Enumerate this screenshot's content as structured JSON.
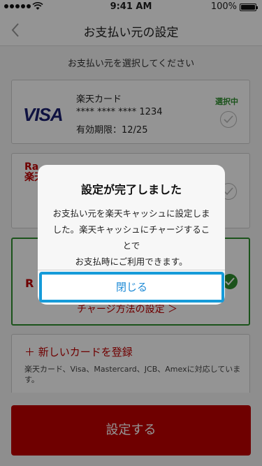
{
  "status_bar": {
    "time": "9:41 AM",
    "battery": "100%"
  },
  "nav": {
    "title": "お支払い元の設定"
  },
  "instruction": "お支払い元を選択してください",
  "cards": {
    "visa": {
      "brand": "VISA",
      "name": "楽天カード",
      "number": "**** **** **** 1234",
      "expiry": "有効期限：12/25",
      "selected_label": "選択中"
    },
    "rakuten_logo_line1": "Ra",
    "rakuten_logo_line2": "楽天",
    "cash_logo": "R",
    "charge_link": "チャージ方法の設定 ＞"
  },
  "add_card": {
    "label": "＋ 新しいカードを登録",
    "note": "楽天カード、Visa、Mastercard、JCB、Amexに対応しています。"
  },
  "submit_label": "設定する",
  "modal": {
    "title": "設定が完了しました",
    "line1": "お支払い元を楽天キャッシュに設定しま",
    "line2": "した。楽天キャッシュにチャージするこ",
    "line3": "とで",
    "line4": "お支払時にご利用できます。",
    "close_label": "閉じる"
  },
  "colors": {
    "brand_red": "#bf0000",
    "selected_green": "#2f8f2f",
    "focus_blue": "#169bd9"
  }
}
